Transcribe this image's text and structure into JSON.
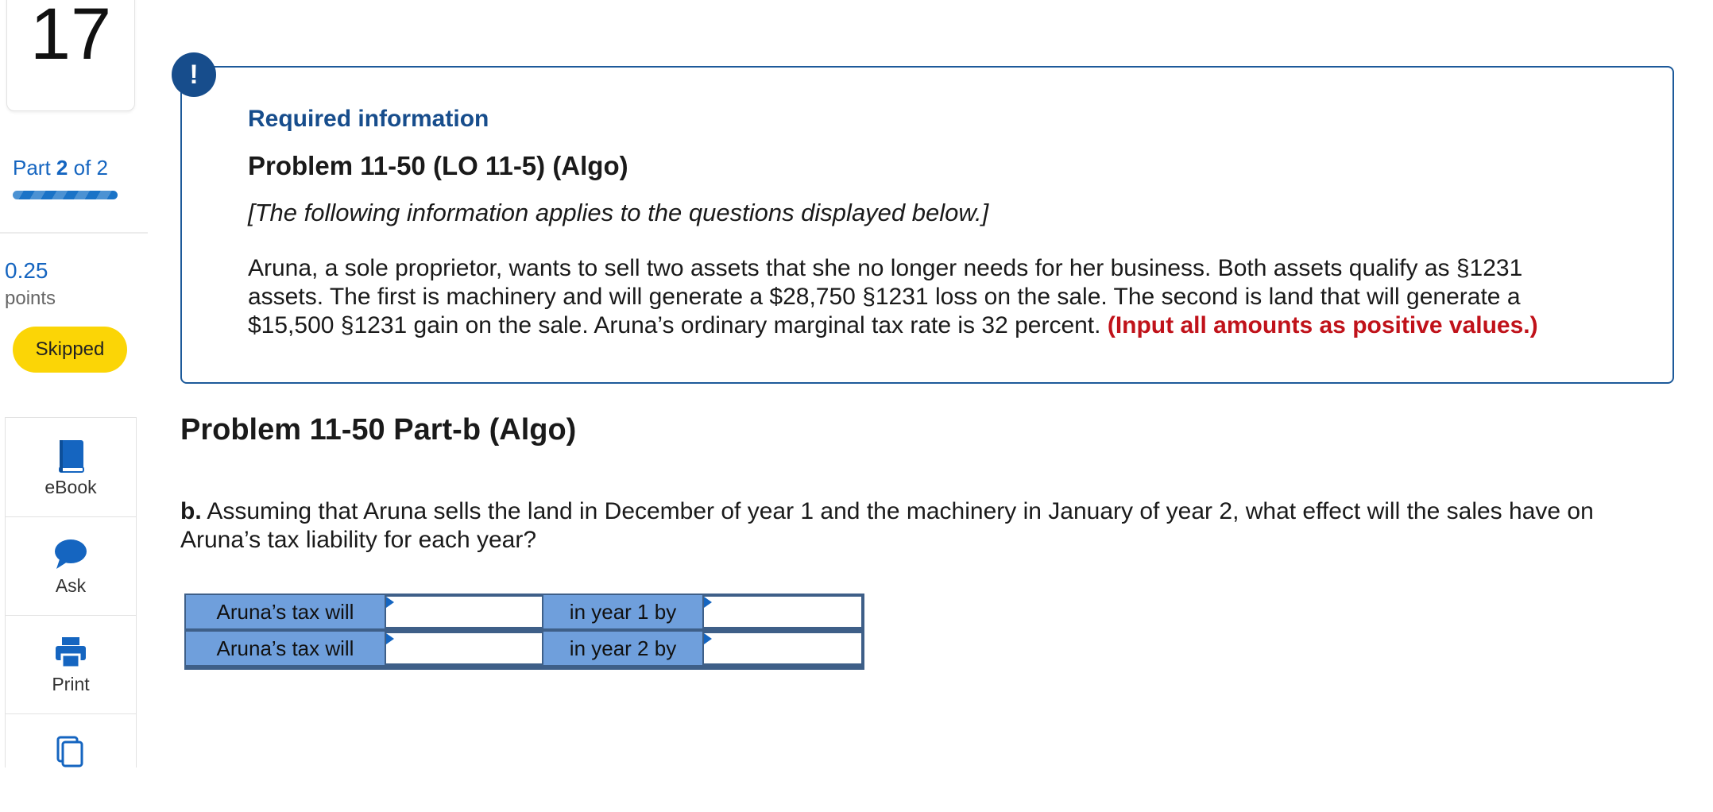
{
  "question_number": "17",
  "progress": {
    "part_label": "Part",
    "part_current": "2",
    "part_of": "of 2",
    "fraction_complete": 1.0
  },
  "points": {
    "value": "0.25",
    "label": "points"
  },
  "status": {
    "label": "Skipped",
    "color": "#fbd506"
  },
  "tools": [
    {
      "label": "eBook",
      "icon": "book-icon"
    },
    {
      "label": "Ask",
      "icon": "chat-bubble-icon"
    },
    {
      "label": "Print",
      "icon": "printer-icon"
    },
    {
      "label": "",
      "icon": "copy-pages-icon"
    }
  ],
  "required_info": {
    "badge": "!",
    "heading": "Required information",
    "problem_title": "Problem 11-50 (LO 11-5) (Algo)",
    "note": "[The following information applies to the questions displayed below.]",
    "paragraph": "Aruna, a sole proprietor, wants to sell two assets that she no longer needs for her business. Both assets qualify as §1231 assets. The first is machinery and will generate a $28,750 §1231 loss on the sale. The second is land that will generate a $15,500 §1231 gain on the sale. Aruna’s ordinary marginal tax rate is 32 percent.",
    "instruction": "(Input all amounts as positive values.)"
  },
  "part_b": {
    "title": "Problem 11-50 Part-b (Algo)",
    "question_prefix": "b.",
    "question_text": "Assuming that Aruna sells the land in December of year 1 and the machinery in January of year 2, what effect will the sales have on Aruna’s tax liability for each year?",
    "rows": [
      {
        "label1": "Aruna’s tax will",
        "select_value": "",
        "label2": "in year 1 by",
        "amount_value": ""
      },
      {
        "label1": "Aruna’s tax will",
        "select_value": "",
        "label2": "in year 2 by",
        "amount_value": ""
      }
    ]
  },
  "colors": {
    "brand_blue": "#174d8c",
    "link_blue": "#1565c0",
    "warning_red": "#c0121a",
    "table_label_bg": "#6f9fdc"
  }
}
